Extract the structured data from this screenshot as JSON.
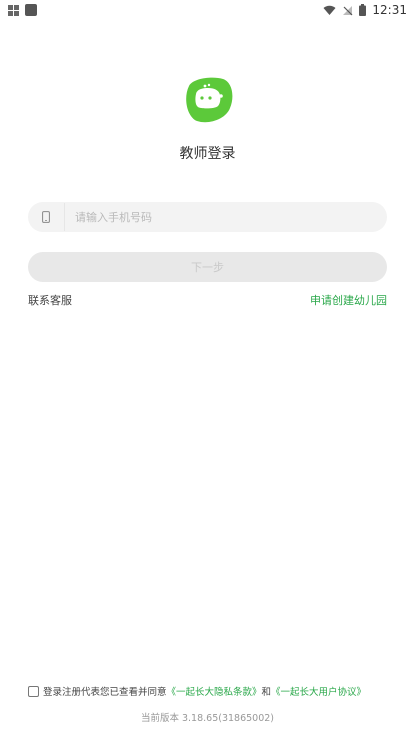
{
  "status": {
    "time": "12:31"
  },
  "login": {
    "title": "教师登录",
    "phone_placeholder": "请输入手机号码",
    "next_label": "下一步",
    "contact_label": "联系客服",
    "apply_label": "申请创建幼儿园"
  },
  "agreement": {
    "prefix": "登录注册代表您已查看并同意",
    "privacy": "《一起长大隐私条款》",
    "and": "和",
    "terms": "《一起长大用户协议》"
  },
  "version": "当前版本 3.18.65(31865002)",
  "colors": {
    "accent": "#2aa84a",
    "logo": "#5cc93a"
  }
}
